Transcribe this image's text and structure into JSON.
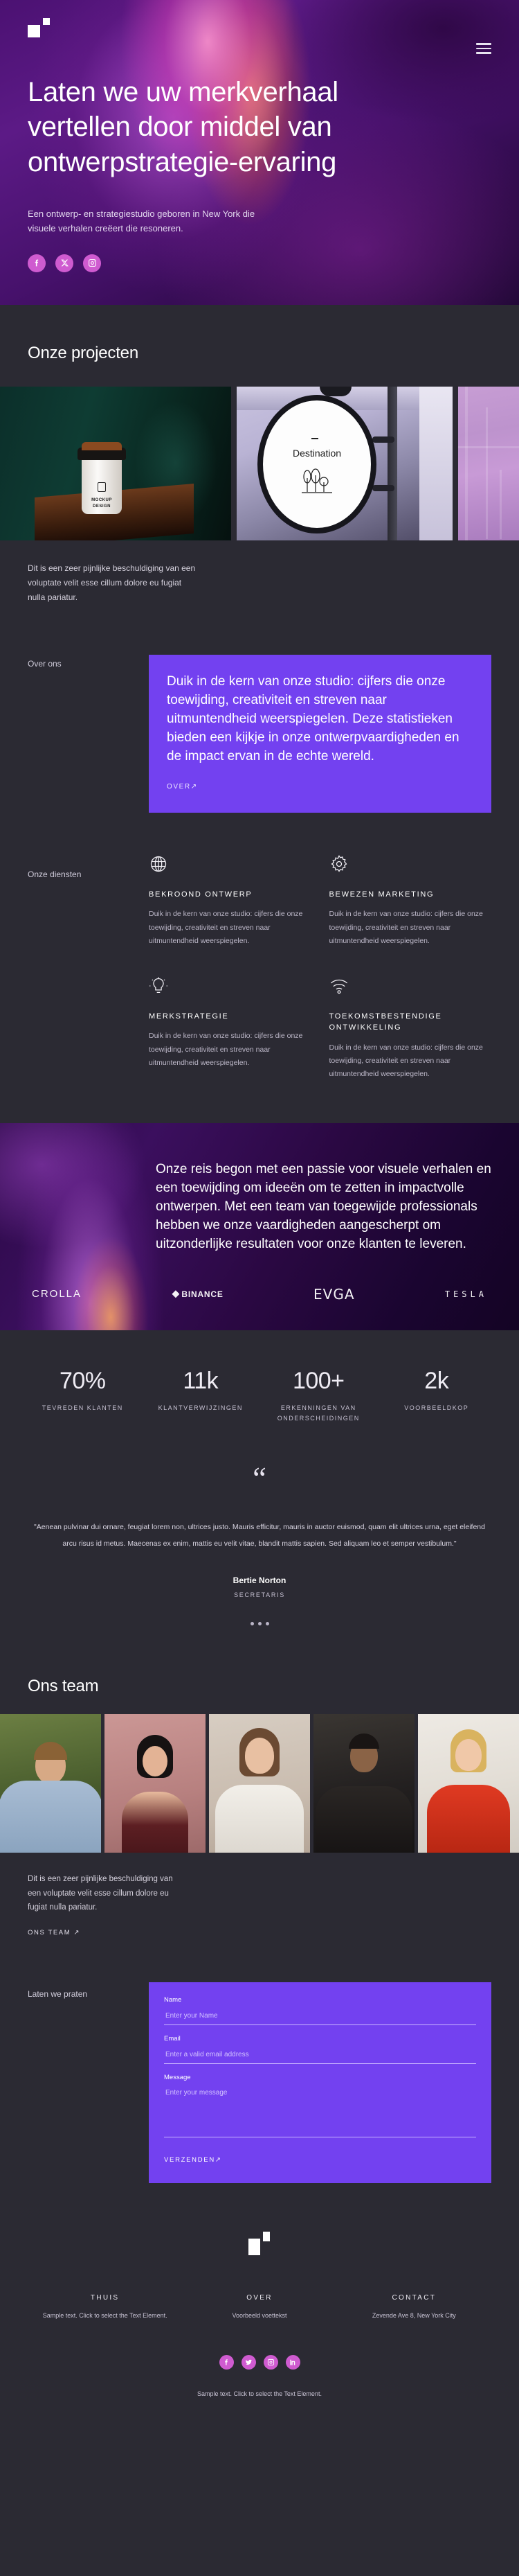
{
  "hero": {
    "logo_icon": "two-squares-logo",
    "menu_icon": "hamburger-menu-icon",
    "title": "Laten we uw merkverhaal vertellen door middel van ontwerpstrategie-ervaring",
    "subtitle": "Een ontwerp- en strategiestudio geboren in New York die visuele verhalen creëert die resoneren.",
    "socials": [
      {
        "name": "facebook-icon",
        "label": "Facebook"
      },
      {
        "name": "x-twitter-icon",
        "label": "X"
      },
      {
        "name": "instagram-icon",
        "label": "Instagram"
      }
    ]
  },
  "projects": {
    "title": "Onze projecten",
    "images": [
      {
        "name": "project-coffee-cup-mockup",
        "caption": "MOCKUP",
        "caption2": "DESIGN"
      },
      {
        "name": "project-destination-sign",
        "caption": "Destination"
      },
      {
        "name": "project-lilac-fabric",
        "caption": ""
      }
    ],
    "note": "Dit is een zeer pijnlijke beschuldiging van een voluptate velit esse cillum dolore eu fugiat nulla pariatur."
  },
  "about": {
    "label": "Over ons",
    "text": "Duik in de kern van onze studio: cijfers die onze toewijding, creativiteit en streven naar uitmuntendheid weerspiegelen. Deze statistieken bieden een kijkje in onze ontwerpvaardigheden en de impact ervan in de echte wereld.",
    "link": "OVER",
    "accent": "#7341f0"
  },
  "services": {
    "label": "Onze diensten",
    "items": [
      {
        "icon": "globe-icon",
        "title": "BEKROOND ONTWERP",
        "text": "Duik in de kern van onze studio: cijfers die onze toewijding, creativiteit en streven naar uitmuntendheid weerspiegelen."
      },
      {
        "icon": "gear-icon",
        "title": "BEWEZEN MARKETING",
        "text": "Duik in de kern van onze studio: cijfers die onze toewijding, creativiteit en streven naar uitmuntendheid weerspiegelen."
      },
      {
        "icon": "lightbulb-icon",
        "title": "MERKSTRATEGIE",
        "text": "Duik in de kern van onze studio: cijfers die onze toewijding, creativiteit en streven naar uitmuntendheid weerspiegelen."
      },
      {
        "icon": "wifi-icon",
        "title": "TOEKOMSTBESTENDIGE ONTWIKKELING",
        "text": "Duik in de kern van onze studio: cijfers die onze toewijding, creativiteit en streven naar uitmuntendheid weerspiegelen."
      }
    ]
  },
  "journey": {
    "text": "Onze reis begon met een passie voor visuele verhalen en een toewijding om ideeën om te zetten in impactvolle ontwerpen. Met een team van toegewijde professionals hebben we onze vaardigheden aangescherpt om uitzonderlijke resultaten voor onze klanten te leveren.",
    "brands": [
      {
        "name": "brand-crolla",
        "label": "CROLLA"
      },
      {
        "name": "brand-binance",
        "label": "BINANCE"
      },
      {
        "name": "brand-evga",
        "label": "EVGA"
      },
      {
        "name": "brand-tesla",
        "label": "TESLA"
      }
    ]
  },
  "stats": [
    {
      "value": "70%",
      "label": "TEVREDEN KLANTEN"
    },
    {
      "value": "11k",
      "label": "KLANTVERWIJZINGEN"
    },
    {
      "value": "100+",
      "label": "ERKENNINGEN VAN ONDERSCHEIDINGEN"
    },
    {
      "value": "2k",
      "label": "VOORBEELDKOP"
    }
  ],
  "testimonial": {
    "quote_icon": "quote-mark-icon",
    "text": "\"Aenean pulvinar dui ornare, feugiat lorem non, ultrices justo. Mauris efficitur, mauris in auctor euismod, quam elit ultrices urna, eget eleifend arcu risus id metus. Maecenas ex enim, mattis eu velit vitae, blandit mattis sapien. Sed aliquam leo et semper vestibulum.\"",
    "name": "Bertie Norton",
    "role": "SECRETARIS",
    "dots": 3
  },
  "team": {
    "title": "Ons team",
    "members": [
      {
        "name": "team-photo-1"
      },
      {
        "name": "team-photo-2"
      },
      {
        "name": "team-photo-3"
      },
      {
        "name": "team-photo-4"
      },
      {
        "name": "team-photo-5"
      }
    ],
    "note": "Dit is een zeer pijnlijke beschuldiging van een voluptate velit esse cillum dolore eu fugiat nulla pariatur.",
    "link": "ONS TEAM"
  },
  "contact": {
    "label": "Laten we praten",
    "fields": {
      "name_label": "Name",
      "name_placeholder": "Enter your Name",
      "name_value": "",
      "email_label": "Email",
      "email_placeholder": "Enter a valid email address",
      "email_value": "",
      "message_label": "Message",
      "message_placeholder": "Enter your message",
      "message_value": ""
    },
    "submit": "VERZENDEN"
  },
  "footer": {
    "logo_icon": "two-squares-logo",
    "columns": [
      {
        "heading": "THUIS",
        "text": "Sample text. Click to select the Text Element."
      },
      {
        "heading": "OVER",
        "text": "Voorbeeld voettekst"
      },
      {
        "heading": "CONTACT",
        "text": "Zevende Ave 8, New York City"
      }
    ],
    "socials": [
      {
        "name": "facebook-icon"
      },
      {
        "name": "twitter-icon"
      },
      {
        "name": "instagram-icon"
      },
      {
        "name": "linkedin-icon"
      }
    ],
    "bottom_text": "Sample text. Click to select the Text Element."
  }
}
